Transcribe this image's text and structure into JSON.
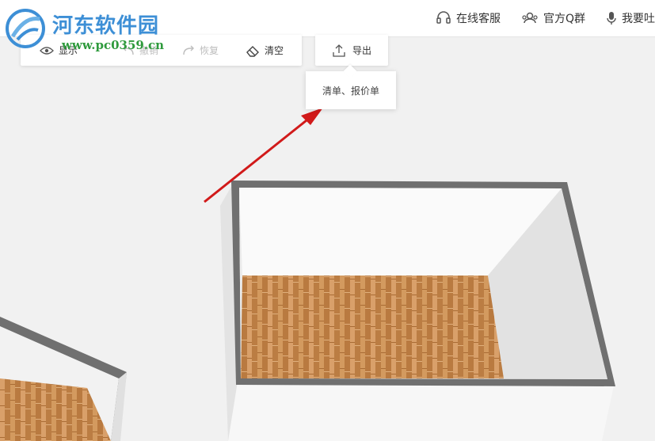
{
  "watermark": {
    "title": "河东软件园",
    "url": "www.pc0359.cn"
  },
  "header": {
    "links": [
      {
        "label": "在线客服",
        "icon": "headset-icon"
      },
      {
        "label": "官方Q群",
        "icon": "group-icon"
      },
      {
        "label": "我要吐",
        "icon": "microphone-icon"
      }
    ]
  },
  "toolbar": {
    "show_label": "显示",
    "undo_label": "撤销",
    "redo_label": "恢复",
    "clear_label": "清空"
  },
  "export": {
    "label": "导出",
    "menu_item": "清单、报价单"
  },
  "colors": {
    "accent_blue": "#3d8fd6",
    "url_green": "#2e9a3c",
    "annotation_arrow": "#d11a1a",
    "wall": "#6f6f6f",
    "floor": "#c68a4d"
  }
}
